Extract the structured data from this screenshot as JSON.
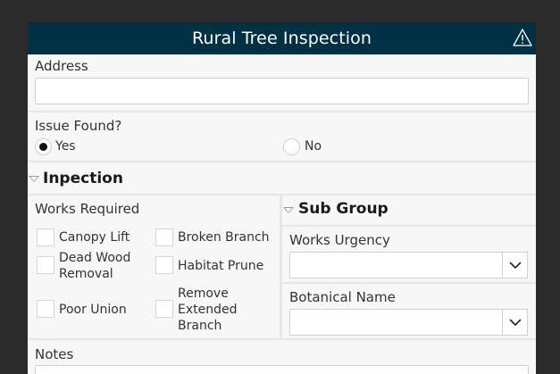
{
  "header": {
    "title": "Rural Tree Inspection",
    "warning_icon": "warning-triangle-icon"
  },
  "address": {
    "label": "Address",
    "value": "",
    "placeholder": ""
  },
  "issue_found": {
    "label": "Issue Found?",
    "options": [
      {
        "label": "Yes",
        "selected": true
      },
      {
        "label": "No",
        "selected": false
      }
    ]
  },
  "inspection": {
    "title": "Inpection",
    "works_required": {
      "label": "Works Required",
      "options": [
        {
          "label": "Canopy Lift",
          "checked": false
        },
        {
          "label": "Broken Branch",
          "checked": false
        },
        {
          "label": "Dead Wood Removal",
          "checked": false
        },
        {
          "label": "Habitat Prune",
          "checked": false
        },
        {
          "label": "Poor Union",
          "checked": false
        },
        {
          "label": "Remove Extended Branch",
          "checked": false
        }
      ]
    },
    "sub_group": {
      "title": "Sub Group",
      "works_urgency": {
        "label": "Works Urgency",
        "value": ""
      },
      "botanical_name": {
        "label": "Botanical Name",
        "value": ""
      }
    }
  },
  "notes": {
    "label": "Notes",
    "value": ""
  },
  "colors": {
    "header_bg": "#003044",
    "form_bg": "#f7f7f7",
    "divider": "#e6e6e6",
    "page_bg": "#2b2b2b"
  }
}
